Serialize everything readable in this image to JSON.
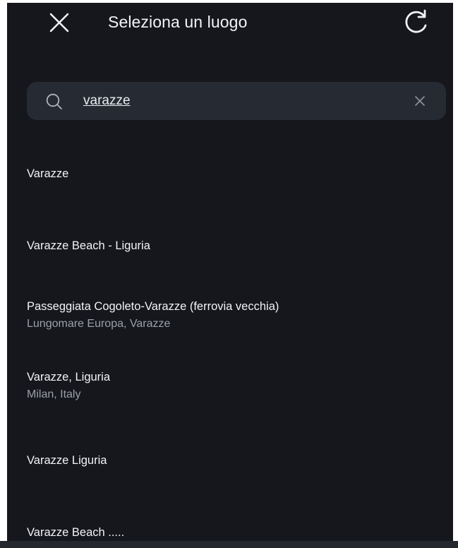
{
  "header": {
    "title": "Seleziona un luogo",
    "close_icon": "close-icon",
    "refresh_icon": "refresh-icon"
  },
  "search": {
    "value": "varazze",
    "search_icon": "search-icon",
    "clear_icon": "clear-icon"
  },
  "results": [
    {
      "title": "Varazze",
      "subtitle": ""
    },
    {
      "title": "Varazze Beach - Liguria",
      "subtitle": ""
    },
    {
      "title": "Passeggiata Cogoleto-Varazze (ferrovia vecchia)",
      "subtitle": "Lungomare Europa, Varazze"
    },
    {
      "title": "Varazze, Liguria",
      "subtitle": "Milan, Italy"
    },
    {
      "title": "Varazze Liguria",
      "subtitle": ""
    },
    {
      "title": "Varazze Beach .....",
      "subtitle": ""
    }
  ],
  "colors": {
    "background": "#15171c",
    "search_bar": "#262a33",
    "primary_text": "#f2f3f5",
    "secondary_text": "#9aa0aa"
  }
}
